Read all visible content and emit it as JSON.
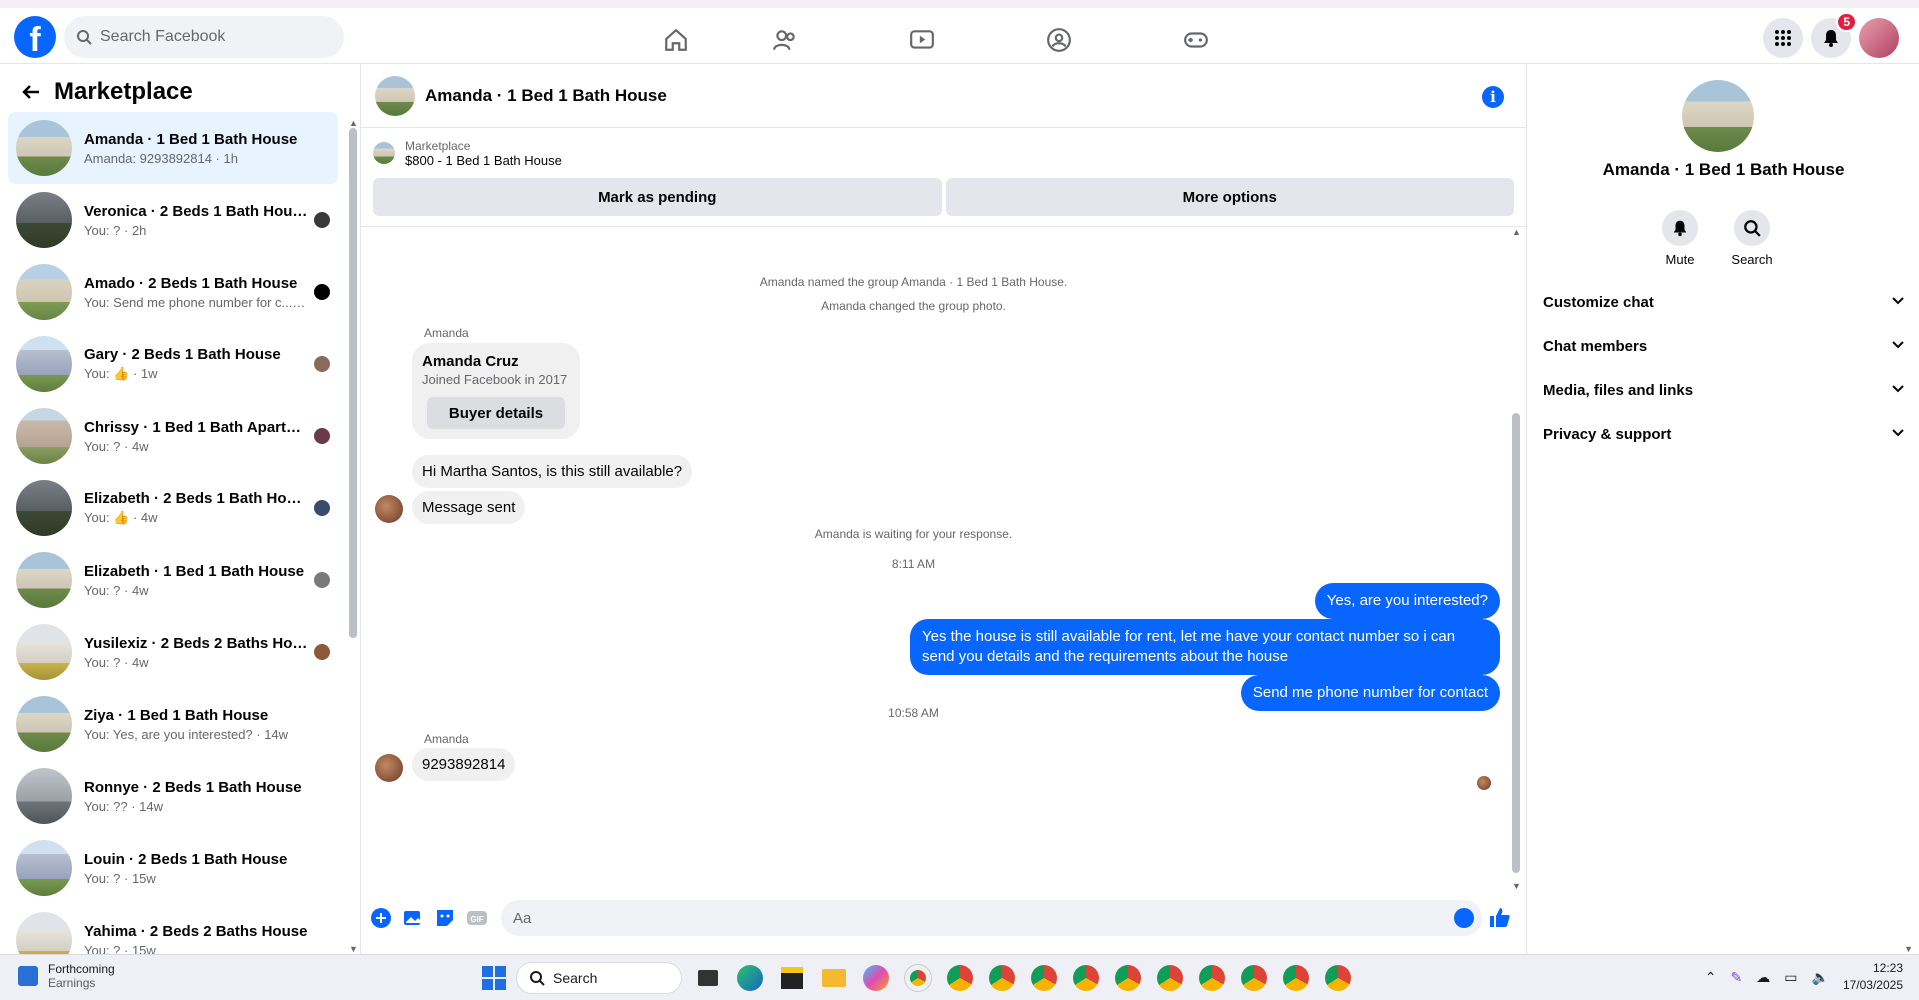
{
  "header": {
    "logo": "f",
    "search_placeholder": "Search Facebook",
    "notification_count": "5",
    "nav_icons": [
      "home-icon",
      "friends-icon",
      "video-icon",
      "groups-icon",
      "gaming-icon"
    ]
  },
  "sidebar": {
    "title": "Marketplace",
    "conversations": [
      {
        "name": "Amanda · 1 Bed 1 Bath House",
        "preview": "Amanda: 9293892814 · 1h",
        "active": true
      },
      {
        "name": "Veronica · 2 Beds 1 Bath House",
        "preview": "You: ? · 2h"
      },
      {
        "name": "Amado · 2 Beds 1 Bath House",
        "preview": "You: Send me phone number for c... · 1w"
      },
      {
        "name": "Gary · 2 Beds 1 Bath House",
        "preview": "You: 👍 · 1w"
      },
      {
        "name": "Chrissy · 1 Bed 1 Bath Apartm...",
        "preview": "You: ? · 4w"
      },
      {
        "name": "Elizabeth · 2 Beds 1 Bath House",
        "preview": "You: 👍 · 4w"
      },
      {
        "name": "Elizabeth · 1 Bed 1 Bath House",
        "preview": "You: ? · 4w"
      },
      {
        "name": "Yusilexiz · 2 Beds 2 Baths House",
        "preview": "You: ? · 4w"
      },
      {
        "name": "Ziya · 1 Bed 1 Bath House",
        "preview": "You: Yes, are you interested? · 14w"
      },
      {
        "name": "Ronnye · 2 Beds 1 Bath House",
        "preview": "You: ?? · 14w"
      },
      {
        "name": "Louin · 2 Beds 1 Bath House",
        "preview": "You: ? · 15w"
      },
      {
        "name": "Yahima · 2 Beds 2 Baths House",
        "preview": "You: ? · 15w"
      }
    ]
  },
  "chat": {
    "title": "Amanda · 1 Bed 1 Bath House",
    "marketplace_label": "Marketplace",
    "listing": "$800 - 1 Bed 1 Bath House",
    "mark_pending": "Mark as pending",
    "more_options": "More options",
    "sys_named": "Amanda named the group Amanda · 1 Bed 1 Bath House.",
    "sys_photo": "Amanda changed the group photo.",
    "sender_name": "Amanda",
    "card_name": "Amanda Cruz",
    "card_sub": "Joined Facebook in 2017",
    "card_btn": "Buyer details",
    "msg1": "Hi Martha Santos, is this still available?",
    "msg2": "Message sent",
    "sys_waiting": "Amanda is waiting for your response.",
    "time1": "8:11 AM",
    "out1": "Yes, are you interested?",
    "out2": "Yes the house is still available for rent, let me have your contact number so i can send you details and the requirements about the house",
    "out3": "Send me phone number for contact",
    "time2": "10:58 AM",
    "sender_name2": "Amanda",
    "msg3": "9293892814",
    "composer_placeholder": "Aa"
  },
  "details": {
    "name": "Amanda · 1 Bed 1 Bath House",
    "mute": "Mute",
    "search": "Search",
    "sections": [
      "Customize chat",
      "Chat members",
      "Media, files and links",
      "Privacy & support"
    ]
  },
  "taskbar": {
    "weather_title": "Forthcoming",
    "weather_sub": "Earnings",
    "search": "Search",
    "time": "12:23",
    "date": "17/03/2025"
  },
  "colors": {
    "brand": "#0866ff",
    "out_bubble": "#0866ff",
    "in_bubble": "#f0f0f0"
  }
}
